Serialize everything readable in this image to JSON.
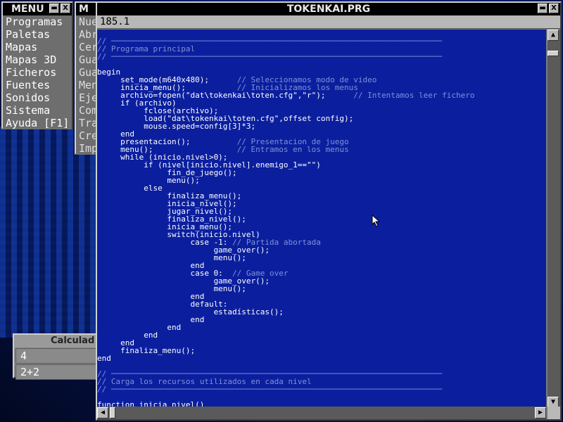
{
  "menu_window": {
    "title": "MENU",
    "close_glyph": "X",
    "items": [
      "Programas",
      "Paletas",
      "Mapas",
      "Mapas 3D",
      "Ficheros",
      "Fuentes",
      "Sonidos",
      "Sistema",
      "Ayuda [F1]"
    ]
  },
  "bg_menu_window": {
    "title_initial": "M",
    "items": [
      "Nue",
      "Abr",
      "Cer",
      "Gua",
      "Gua",
      "Men",
      "Eje",
      "Com",
      "Tra",
      "Cre",
      "Imp"
    ]
  },
  "calc_window": {
    "title": "Calculad",
    "display": "4",
    "expression": "2+2"
  },
  "editor": {
    "title": "TOKENKAI.PRG",
    "status": "185.1",
    "lines": [
      {
        "c": "",
        "m": ""
      },
      {
        "c": "",
        "m": "// ───────────────────────────────────────────────────────────────────────"
      },
      {
        "c": "",
        "m": "// Programa principal"
      },
      {
        "c": "",
        "m": "// ───────────────────────────────────────────────────────────────────────"
      },
      {
        "c": "",
        "m": ""
      },
      {
        "c": "begin",
        "m": ""
      },
      {
        "c": "     set_mode(m640x480);      ",
        "m": "// Seleccionamos modo de video"
      },
      {
        "c": "     inicia_menu();           ",
        "m": "// Inicializamos los menus"
      },
      {
        "c": "     archivo=fopen(\"dat\\tokenkai\\toten.cfg\",\"r\");      ",
        "m": "// Intentamos leer fichero"
      },
      {
        "c": "     if (archivo)",
        "m": ""
      },
      {
        "c": "          fclose(archivo);",
        "m": ""
      },
      {
        "c": "          load(\"dat\\tokenkai\\toten.cfg\",offset config);",
        "m": ""
      },
      {
        "c": "          mouse.speed=config[3]*3;",
        "m": ""
      },
      {
        "c": "     end",
        "m": ""
      },
      {
        "c": "     presentacion();          ",
        "m": "// Presentacion de juego"
      },
      {
        "c": "     menu();                  ",
        "m": "// Entramos en los menus"
      },
      {
        "c": "     while (inicio.nivel>0);",
        "m": ""
      },
      {
        "c": "          if (nivel[inicio.nivel].enemigo_1==\"\")",
        "m": ""
      },
      {
        "c": "               fin_de_juego();",
        "m": ""
      },
      {
        "c": "               menu();",
        "m": ""
      },
      {
        "c": "          else",
        "m": ""
      },
      {
        "c": "               finaliza_menu();",
        "m": ""
      },
      {
        "c": "               inicia_nivel();",
        "m": ""
      },
      {
        "c": "               jugar_nivel();",
        "m": ""
      },
      {
        "c": "               finaliza_nivel();",
        "m": ""
      },
      {
        "c": "               inicia_menu();",
        "m": ""
      },
      {
        "c": "               switch(inicio.nivel)",
        "m": ""
      },
      {
        "c": "                    case -1: ",
        "m": "// Partida abortada"
      },
      {
        "c": "                         game_over();",
        "m": ""
      },
      {
        "c": "                         menu();",
        "m": ""
      },
      {
        "c": "                    end",
        "m": ""
      },
      {
        "c": "                    case 0:  ",
        "m": "// Game over"
      },
      {
        "c": "                         game_over();",
        "m": ""
      },
      {
        "c": "                         menu();",
        "m": ""
      },
      {
        "c": "                    end",
        "m": ""
      },
      {
        "c": "                    default:",
        "m": ""
      },
      {
        "c": "                         estadísticas();",
        "m": ""
      },
      {
        "c": "                    end",
        "m": ""
      },
      {
        "c": "               end",
        "m": ""
      },
      {
        "c": "          end",
        "m": ""
      },
      {
        "c": "     end",
        "m": ""
      },
      {
        "c": "     finaliza_menu();",
        "m": ""
      },
      {
        "c": "end",
        "m": ""
      },
      {
        "c": "",
        "m": ""
      },
      {
        "c": "",
        "m": "// ───────────────────────────────────────────────────────────────────────"
      },
      {
        "c": "",
        "m": "// Carga los recursos utilizados en cada nivel"
      },
      {
        "c": "",
        "m": "// ───────────────────────────────────────────────────────────────────────"
      },
      {
        "c": "",
        "m": ""
      },
      {
        "c": "function inicia_nivel()",
        "m": ""
      }
    ]
  },
  "icons": {
    "close": "close-icon",
    "minimize": "minimize-icon",
    "scroll_up": "arrow-up-icon",
    "scroll_down": "arrow-down-icon",
    "scroll_left": "arrow-left-icon",
    "scroll_right": "arrow-right-icon",
    "cursor": "mouse-pointer-icon"
  }
}
